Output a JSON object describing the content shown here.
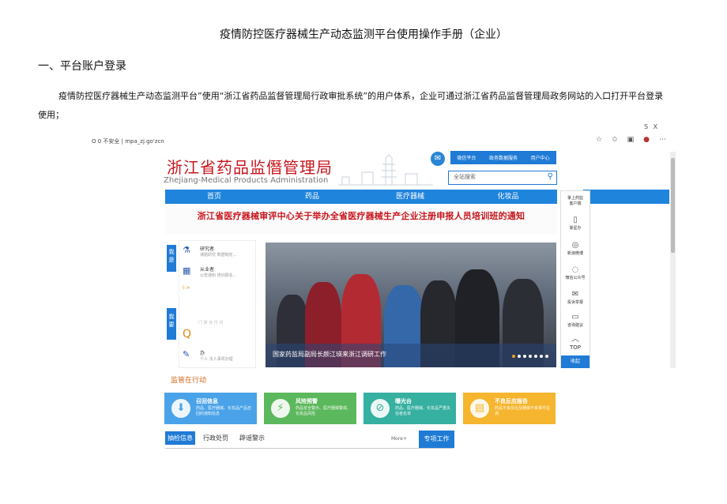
{
  "document": {
    "title": "疫情防控医疗器械生产动态监测平台使用操作手册（企业）",
    "heading": "一、平台账户登录",
    "paragraph": "疫情防控医疗器械生产动态监测平台”使用“浙江省药品监督管理局行政审批系统”的用户体系，企业可通过浙江省药品监督管理局政务网站的入口打开平台登录使用；",
    "corner_text": "S X"
  },
  "browser": {
    "address": "O 0 不安全 | mpa_zj.go'zcn"
  },
  "site": {
    "logo_cn": "浙江省药品监僭管理局",
    "logo_en": "Zhejiang-Medical Products Administration",
    "top_links": [
      "微信平台",
      "政务数据服务",
      "用户中心"
    ],
    "search_placeholder": "全站搜索",
    "nav": [
      "首页",
      "药品",
      "医疗器械",
      "化妆品"
    ],
    "notice": "浙江省医疗器械审评中心关于举办全省医疗器械生产企业注册申报人员培训班的通知",
    "side_tab_1": "我是",
    "side_tab_2": "我要",
    "roles": [
      {
        "title": "研究者",
        "desc": "课题研究  数据制定..."
      },
      {
        "title": "从业者",
        "desc": "公告通知  培训报名..."
      },
      {
        "title": "办",
        "desc": "个人  法人事项办理"
      }
    ],
    "role_misc": "门 禁 点 付 问",
    "banner_caption": "国家药监局副局长颜江瑛来浙江调研工作",
    "sidebar": [
      {
        "label": "掌上药监",
        "sub": "客户端"
      },
      {
        "label": "渐星办"
      },
      {
        "label": "新浪微博"
      },
      {
        "label": "微信公众号"
      },
      {
        "label": "投诉举报"
      },
      {
        "label": "咨询建议"
      },
      {
        "label": "TOP"
      }
    ],
    "sidebar_bottom": "收起",
    "supervise_title": "监管在行动",
    "cards": [
      {
        "title": "召回信息",
        "desc": "药品、医疗器械、化妆品产品召回的通知信息",
        "color": "#4aa3e8"
      },
      {
        "title": "风险预警",
        "desc": "药品安全警示、医疗器械警戒、化妆品风险",
        "color": "#5cb85c"
      },
      {
        "title": "曝光台",
        "desc": "药品、医疗器械、化妆品严重失信者名单",
        "color": "#36b0a0"
      },
      {
        "title": "不良反应报告",
        "desc": "药品不良反应及器械不良事件监测",
        "color": "#f5b52e"
      }
    ],
    "tabs": [
      "抽检信息",
      "行政处罚",
      "辟谣警示"
    ],
    "more": "More+",
    "special": "专项工作"
  }
}
